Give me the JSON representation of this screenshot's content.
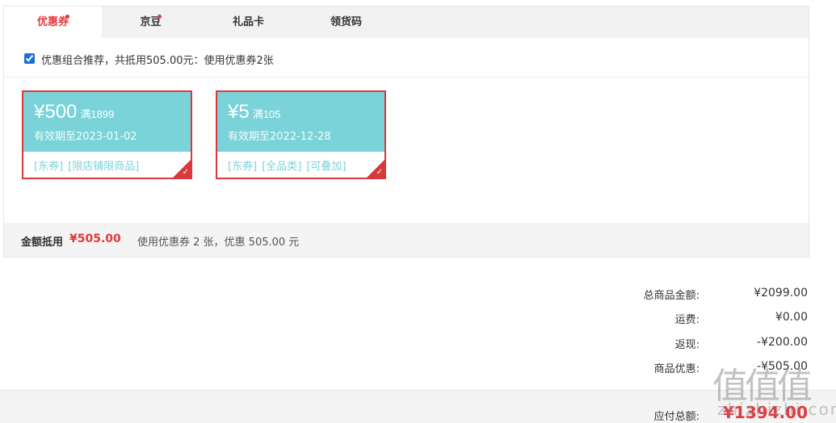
{
  "tabs": [
    {
      "label": "优惠券",
      "active": true,
      "dot": true
    },
    {
      "label": "京豆",
      "active": false,
      "dot": true
    },
    {
      "label": "礼品卡",
      "active": false,
      "dot": false
    },
    {
      "label": "领货码",
      "active": false,
      "dot": false
    }
  ],
  "combo": {
    "checked": true,
    "text": "优惠组合推荐，共抵用505.00元：使用优惠券2张"
  },
  "coupons": [
    {
      "amount": "¥500",
      "condition": "满1899",
      "valid": "有效期至2023-01-02",
      "tags": [
        "[东券]",
        "[限店铺限商品]"
      ],
      "selected": true
    },
    {
      "amount": "¥5",
      "condition": "满105",
      "valid": "有效期至2022-12-28",
      "tags": [
        "[东券]",
        "[全品类]",
        "[可叠加]"
      ],
      "selected": true
    }
  ],
  "summary": {
    "label": "金额抵用",
    "amount": "¥505.00",
    "desc": "使用优惠券 2 张，优惠 505.00 元"
  },
  "totals": [
    {
      "label": "总商品金额:",
      "value": "¥2099.00"
    },
    {
      "label": "运费:",
      "value": "¥0.00"
    },
    {
      "label": "返现:",
      "value": "-¥200.00"
    },
    {
      "label": "商品优惠:",
      "value": "-¥505.00"
    }
  ],
  "payable": {
    "label": "应付总额:",
    "value": "¥1394.00"
  },
  "watermark": {
    "logo": "值值值",
    "url": "zhizhizhi.com"
  },
  "colors": {
    "accent": "#e4393c",
    "coupon_bg": "#7ad3d8"
  },
  "icons": {
    "check": "checkmark-icon"
  }
}
